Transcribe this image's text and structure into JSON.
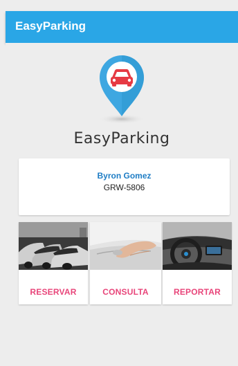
{
  "app_bar": {
    "title": "EasyParking"
  },
  "logo": {
    "icon": "car-location-pin",
    "pin_color": "#3ea7e1",
    "car_color": "#e63a43"
  },
  "brand": {
    "name": "EasyParking"
  },
  "user": {
    "name": "Byron Gomez",
    "plate": "GRW-5806"
  },
  "actions": [
    {
      "label": "RESERVAR",
      "image": "parked-cars-photo"
    },
    {
      "label": "CONSULTA",
      "image": "hand-on-car-door-photo"
    },
    {
      "label": "REPORTAR",
      "image": "car-dashboard-interior-photo"
    }
  ],
  "colors": {
    "primary": "#2aa6e6",
    "accent": "#e8457a",
    "user_name": "#1d7cc4",
    "background": "#ededed"
  }
}
